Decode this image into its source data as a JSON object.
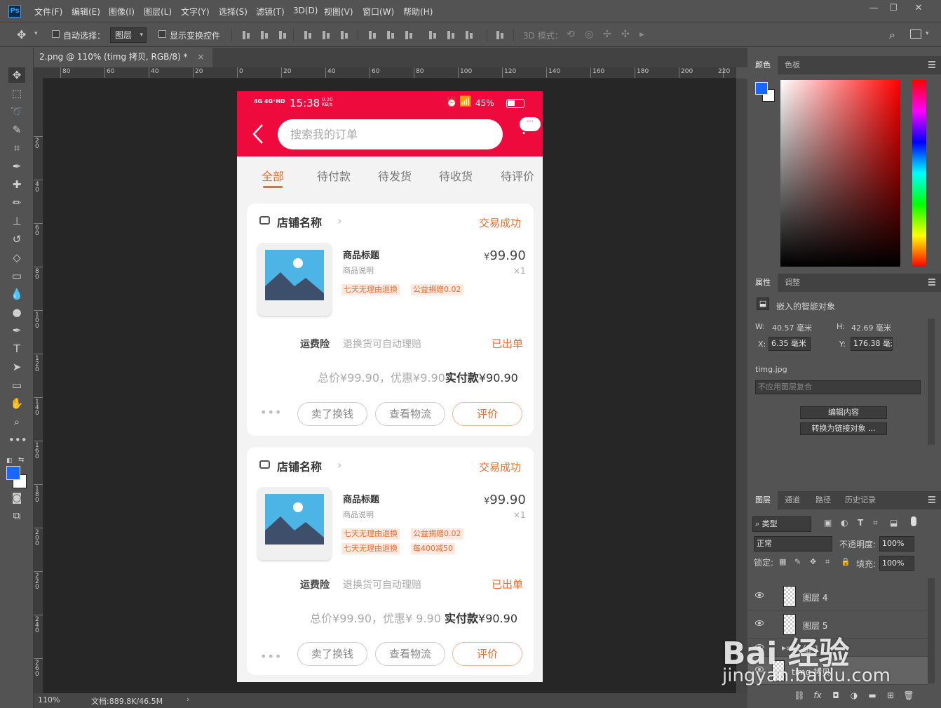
{
  "app": {
    "logo": "Ps",
    "menu": [
      "文件(F)",
      "编辑(E)",
      "图像(I)",
      "图层(L)",
      "文字(Y)",
      "选择(S)",
      "滤镜(T)",
      "3D(D)",
      "视图(V)",
      "窗口(W)",
      "帮助(H)"
    ],
    "window_controls": [
      "—",
      "☐",
      "✕"
    ]
  },
  "options": {
    "auto_select_label": "自动选择：",
    "auto_select_target": "图层",
    "show_transform_label": "显示变换控件",
    "mode_3d_label": "3D 模式："
  },
  "document": {
    "tab_title": "2.png @ 110% (timg 拷贝, RGB/8) *",
    "tab_close": "×",
    "zoom": "110%",
    "doc_size": "文档:889.8K/46.5M",
    "ruler_h": [
      "80",
      "60",
      "40",
      "20",
      "0",
      "20",
      "40",
      "60",
      "80",
      "100",
      "120",
      "140",
      "160",
      "180",
      "200",
      "220"
    ],
    "ruler_v": [
      "2\n0",
      "4\n0",
      "6\n0",
      "8\n0",
      "1\n0\n0",
      "1\n2\n0",
      "1\n4\n0",
      "1\n6\n0",
      "1\n8\n0",
      "2\n0\n0",
      "2\n2\n0",
      "2\n4\n0",
      "2\n6\n0"
    ]
  },
  "phone": {
    "status": {
      "signal": "4G 4G⁺HD",
      "time": "15:38",
      "speed": "0.20\nKB/s",
      "battery": "45%"
    },
    "search_placeholder": "搜索我的订单",
    "tabs": [
      "全部",
      "待付款",
      "待发货",
      "待收货",
      "待评价"
    ],
    "orders": [
      {
        "store": "店铺名称",
        "status": "交易成功",
        "title": "商品标题",
        "desc": "商品说明",
        "price_symbol": "¥",
        "price": "99.90",
        "qty": "×1",
        "tags_row1": [
          "七天无理由退换",
          "公益捐赠0.02"
        ],
        "tags_row2": [],
        "insurance_label": "运费险",
        "insurance_desc": "退换货可自动理赔",
        "insurance_status": "已出单",
        "total_text": "总价",
        "total_value": "¥99.90",
        "discount_text": "，优惠",
        "discount_value": "¥9.90",
        "pay_label": "实付款",
        "pay_value": "¥90.90",
        "buttons": [
          "卖了换钱",
          "查看物流",
          "评价"
        ]
      },
      {
        "store": "店铺名称",
        "status": "交易成功",
        "title": "商品标题",
        "desc": "商品说明",
        "price_symbol": "¥",
        "price": "99.90",
        "qty": "×1",
        "tags_row1": [
          "七天无理由退换",
          "公益捐赠0.02"
        ],
        "tags_row2": [
          "七天无理由退换",
          "每400减50"
        ],
        "insurance_label": "运费险",
        "insurance_desc": "退换货可自动理赔",
        "insurance_status": "已出单",
        "total_text": "总价",
        "total_value": "¥99.90",
        "discount_text": "，优惠",
        "discount_value": "¥ 9.90",
        "pay_label": "实付款",
        "pay_value": "¥90.90",
        "buttons": [
          "卖了换钱",
          "查看物流",
          "评价"
        ]
      }
    ]
  },
  "color_panel": {
    "tabs": [
      "颜色",
      "色板"
    ],
    "foreground": "#1a66ff",
    "background": "#ffffff"
  },
  "properties_panel": {
    "tabs": [
      "属性",
      "调整"
    ],
    "type_label": "嵌入的智能对象",
    "w_label": "W:",
    "w_value": "40.57 毫米",
    "h_label": "H:",
    "h_value": "42.69 毫米",
    "x_label": "X:",
    "x_value": "6.35 毫米",
    "y_label": "Y:",
    "y_value": "176.38 毫米",
    "source_file": "timg.jpg",
    "comp_select": "不应用图层复合",
    "edit_btn": "编辑内容",
    "convert_btn": "转换为链接对象 ..."
  },
  "layers_panel": {
    "tabs": [
      "图层",
      "通道",
      "路径",
      "历史记录"
    ],
    "filter_kind": "类型",
    "blend_mode": "正常",
    "opacity_label": "不透明度:",
    "opacity_value": "100%",
    "lock_label": "锁定:",
    "fill_label": "填充:",
    "fill_value": "100%",
    "layers": [
      "图层 4",
      "图层 5",
      "组 1",
      "timg 拷贝"
    ]
  },
  "watermark": {
    "brand": "Bai 经验",
    "url": "jingyan.baidu.com"
  }
}
